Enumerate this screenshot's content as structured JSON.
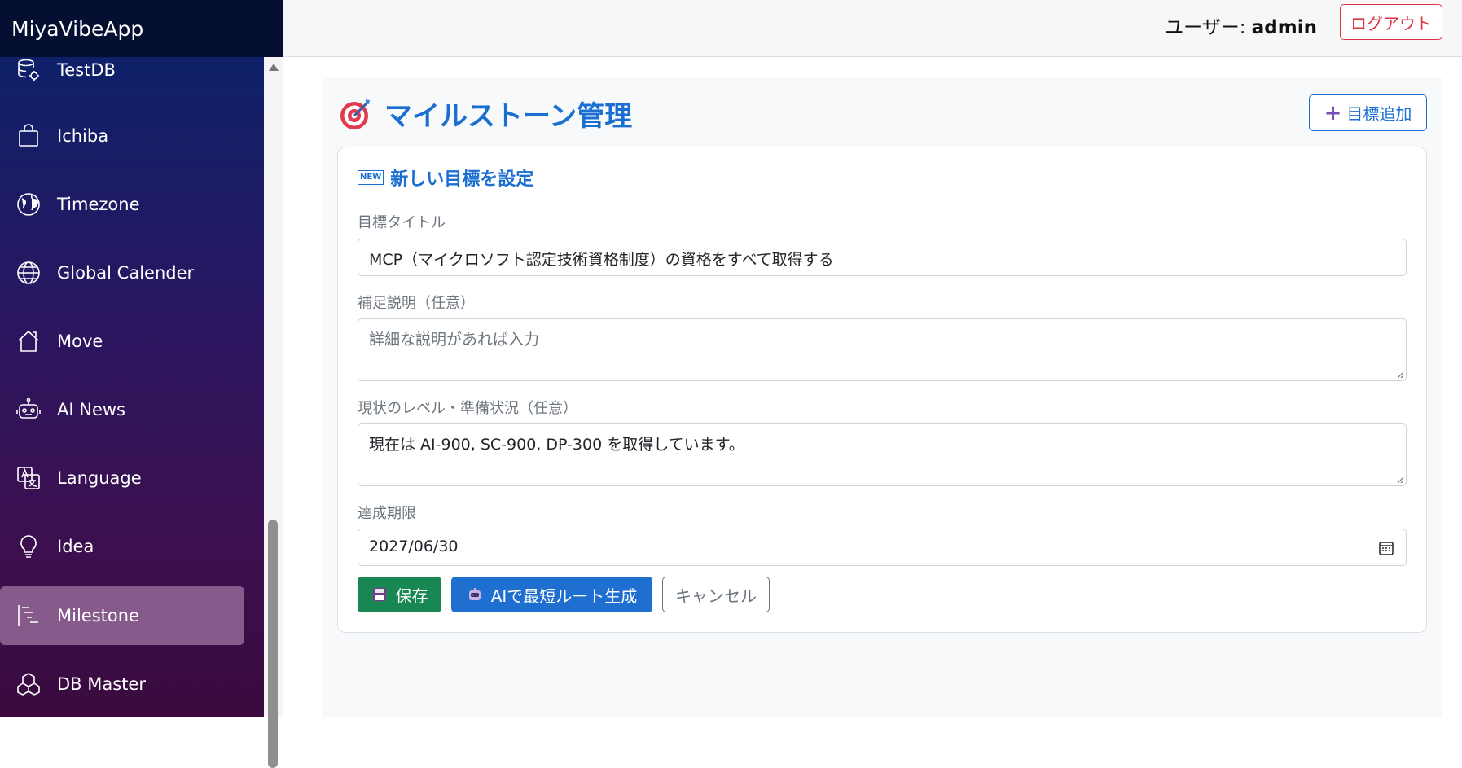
{
  "app": {
    "brand": "MiyaVibeApp"
  },
  "header": {
    "user_prefix": "ユーザー: ",
    "username": "admin",
    "logout_label": "ログアウト"
  },
  "sidebar": {
    "items": [
      {
        "label": "TestDB",
        "icon": "database-gear-icon"
      },
      {
        "label": "Ichiba",
        "icon": "shopping-bag-icon"
      },
      {
        "label": "Timezone",
        "icon": "globe-americas-icon"
      },
      {
        "label": "Global Calender",
        "icon": "globe-icon"
      },
      {
        "label": "Move",
        "icon": "house-icon"
      },
      {
        "label": "AI News",
        "icon": "robot-icon"
      },
      {
        "label": "Language",
        "icon": "translate-icon"
      },
      {
        "label": "Idea",
        "icon": "lightbulb-icon"
      },
      {
        "label": "Milestone",
        "icon": "bar-chart-steps-icon",
        "active": true
      },
      {
        "label": "DB Master",
        "icon": "boxes-icon"
      }
    ]
  },
  "page": {
    "title": "マイルストーン管理",
    "add_button": "目標追加"
  },
  "form": {
    "title": "新しい目標を設定",
    "new_badge": "NEW",
    "goal_title_label": "目標タイトル",
    "goal_title_value": "MCP（マイクロソフト認定技術資格制度）の資格をすべて取得する",
    "description_label": "補足説明（任意）",
    "description_placeholder": "詳細な説明があれば入力",
    "status_label": "現状のレベル・準備状況（任意）",
    "status_value": "現在は AI-900, SC-900, DP-300 を取得しています。",
    "deadline_label": "達成期限",
    "deadline_value": "2027/06/30",
    "save_label": "保存",
    "ai_label": "AIで最短ルート生成",
    "cancel_label": "キャンセル"
  },
  "colors": {
    "accent": "#1a6fd1",
    "save": "#198754",
    "danger": "#dc3545",
    "active_nav": "#865b8c"
  }
}
